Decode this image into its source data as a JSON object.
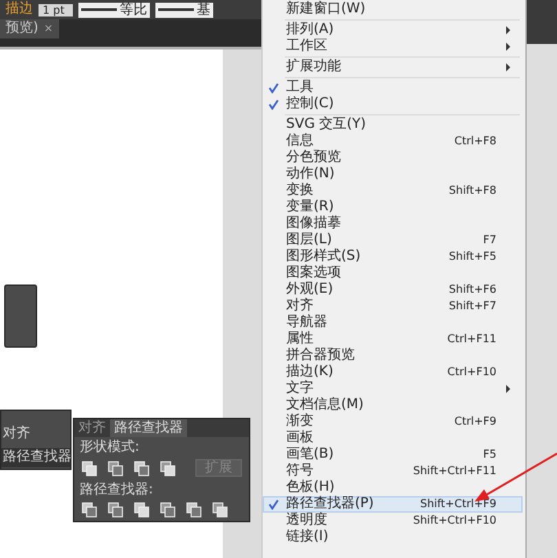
{
  "control_bar": {
    "stroke_label": "描边",
    "stroke_weight": "1 pt",
    "profile": "等比",
    "brush": "基"
  },
  "document_tab": {
    "title": "预览)",
    "close": "×"
  },
  "dock": {
    "items": [
      {
        "label": "对齐",
        "selected": false
      },
      {
        "label": "路径查找器",
        "selected": true
      }
    ]
  },
  "pathfinder_panel": {
    "tabs": [
      {
        "label": "对齐",
        "selected": false
      },
      {
        "label": "路径查找器",
        "selected": true
      }
    ],
    "shape_modes_label": "形状模式:",
    "expand_button": "扩展",
    "pathfinders_label": "路径查找器:"
  },
  "menu": {
    "items": [
      {
        "kind": "item",
        "label": "新建窗口(W)",
        "checked": false,
        "selected": false,
        "submenu": false
      },
      {
        "kind": "separator"
      },
      {
        "kind": "item",
        "label": "排列(A)",
        "checked": false,
        "selected": false,
        "submenu": true
      },
      {
        "kind": "item",
        "label": "工作区",
        "checked": false,
        "selected": false,
        "submenu": true
      },
      {
        "kind": "separator"
      },
      {
        "kind": "item",
        "label": "扩展功能",
        "checked": false,
        "selected": false,
        "submenu": true
      },
      {
        "kind": "separator"
      },
      {
        "kind": "item",
        "label": "工具",
        "checked": true,
        "selected": false,
        "submenu": false
      },
      {
        "kind": "item",
        "label": "控制(C)",
        "checked": true,
        "selected": false,
        "submenu": false
      },
      {
        "kind": "separator"
      },
      {
        "kind": "item",
        "label": "SVG 交互(Y)",
        "checked": false,
        "selected": false,
        "submenu": false
      },
      {
        "kind": "item",
        "label": "信息",
        "shortcut": "Ctrl+F8",
        "checked": false,
        "selected": false,
        "submenu": false
      },
      {
        "kind": "item",
        "label": "分色预览",
        "checked": false,
        "selected": false,
        "submenu": false
      },
      {
        "kind": "item",
        "label": "动作(N)",
        "checked": false,
        "selected": false,
        "submenu": false
      },
      {
        "kind": "item",
        "label": "变换",
        "shortcut": "Shift+F8",
        "checked": false,
        "selected": false,
        "submenu": false
      },
      {
        "kind": "item",
        "label": "变量(R)",
        "checked": false,
        "selected": false,
        "submenu": false
      },
      {
        "kind": "item",
        "label": "图像描摹",
        "checked": false,
        "selected": false,
        "submenu": false
      },
      {
        "kind": "item",
        "label": "图层(L)",
        "shortcut": "F7",
        "checked": false,
        "selected": false,
        "submenu": false
      },
      {
        "kind": "item",
        "label": "图形样式(S)",
        "shortcut": "Shift+F5",
        "checked": false,
        "selected": false,
        "submenu": false
      },
      {
        "kind": "item",
        "label": "图案选项",
        "checked": false,
        "selected": false,
        "submenu": false
      },
      {
        "kind": "item",
        "label": "外观(E)",
        "shortcut": "Shift+F6",
        "checked": false,
        "selected": false,
        "submenu": false
      },
      {
        "kind": "item",
        "label": "对齐",
        "shortcut": "Shift+F7",
        "checked": false,
        "selected": false,
        "submenu": false
      },
      {
        "kind": "item",
        "label": "导航器",
        "checked": false,
        "selected": false,
        "submenu": false
      },
      {
        "kind": "item",
        "label": "属性",
        "shortcut": "Ctrl+F11",
        "checked": false,
        "selected": false,
        "submenu": false
      },
      {
        "kind": "item",
        "label": "拼合器预览",
        "checked": false,
        "selected": false,
        "submenu": false
      },
      {
        "kind": "item",
        "label": "描边(K)",
        "shortcut": "Ctrl+F10",
        "checked": false,
        "selected": false,
        "submenu": false
      },
      {
        "kind": "item",
        "label": "文字",
        "checked": false,
        "selected": false,
        "submenu": true
      },
      {
        "kind": "item",
        "label": "文档信息(M)",
        "checked": false,
        "selected": false,
        "submenu": false
      },
      {
        "kind": "item",
        "label": "渐变",
        "shortcut": "Ctrl+F9",
        "checked": false,
        "selected": false,
        "submenu": false
      },
      {
        "kind": "item",
        "label": "画板",
        "checked": false,
        "selected": false,
        "submenu": false
      },
      {
        "kind": "item",
        "label": "画笔(B)",
        "shortcut": "F5",
        "checked": false,
        "selected": false,
        "submenu": false
      },
      {
        "kind": "item",
        "label": "符号",
        "shortcut": "Shift+Ctrl+F11",
        "checked": false,
        "selected": false,
        "submenu": false
      },
      {
        "kind": "item",
        "label": "色板(H)",
        "checked": false,
        "selected": false,
        "submenu": false
      },
      {
        "kind": "item",
        "label": "路径查找器(P)",
        "shortcut": "Shift+Ctrl+F9",
        "checked": true,
        "selected": true,
        "submenu": false
      },
      {
        "kind": "item",
        "label": "透明度",
        "shortcut": "Shift+Ctrl+F10",
        "checked": false,
        "selected": false,
        "submenu": false
      },
      {
        "kind": "item",
        "label": "链接(I)",
        "checked": false,
        "selected": false,
        "submenu": false
      }
    ]
  }
}
